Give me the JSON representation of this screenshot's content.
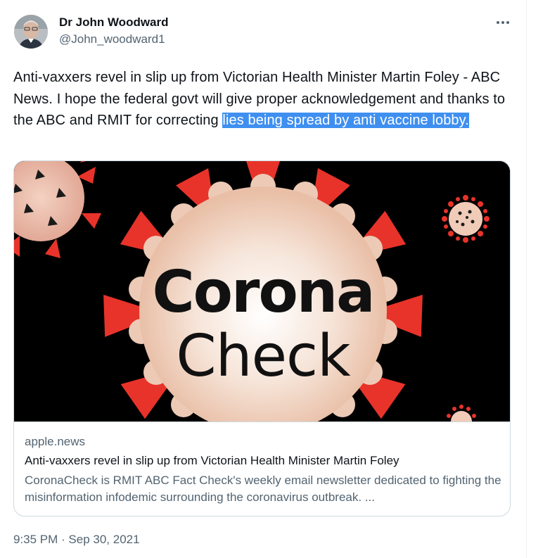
{
  "author": {
    "name": "Dr John Woodward",
    "handle": "@John_woodward1"
  },
  "menu_icon": "more-horizontal-icon",
  "tweet": {
    "text_before": "Anti-vaxxers revel in slip up from Victorian Health Minister Martin Foley - ABC News. I hope the federal govt will give proper acknowledgement and thanks to the ABC and RMIT for correcting ",
    "text_selected": "lies being spread by anti vaccine lobby."
  },
  "card": {
    "image_word_1": "Corona",
    "image_word_2": "Check",
    "domain": "apple.news",
    "title": "Anti-vaxxers revel in slip up from Victorian Health Minister Martin Foley",
    "description": "CoronaCheck is RMIT ABC Fact Check's weekly email newsletter dedicated to fighting the misinformation infodemic surrounding the coronavirus outbreak. ..."
  },
  "timestamp": "9:35 PM · Sep 30, 2021",
  "colors": {
    "selection": "#3f8ff0",
    "virus_spike": "#e8332a",
    "virus_body": "#f2d6c4",
    "secondary_text": "#536471"
  }
}
